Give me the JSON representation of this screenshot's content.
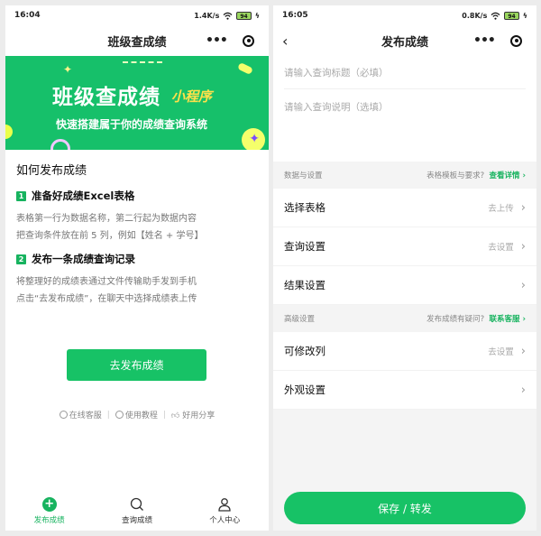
{
  "left": {
    "status": {
      "time": "16:04",
      "speed": "1.4K/s",
      "battery": "94"
    },
    "title": "班级查成绩",
    "banner": {
      "title": "班级查成绩",
      "mini": "小程序",
      "subtitle": "快速搭建属于你的成绩查询系统"
    },
    "howto_title": "如何发布成绩",
    "steps": [
      {
        "num": "1",
        "title": "准备好成绩Excel表格",
        "lines": [
          "表格第一行为数据名称，第二行起为数据内容",
          "把查询条件放在前 5 列，例如【姓名 + 学号】"
        ]
      },
      {
        "num": "2",
        "title": "发布一条成绩查询记录",
        "lines": [
          "将整理好的成绩表通过文件传输助手发到手机",
          "点击“去发布成绩”，在聊天中选择成绩表上传"
        ]
      }
    ],
    "publish_button": "去发布成绩",
    "links": [
      "在线客服",
      "使用教程",
      "好用分享"
    ],
    "tabs": [
      {
        "label": "发布成绩",
        "icon": "plus-circle-icon"
      },
      {
        "label": "查询成绩",
        "icon": "search-icon"
      },
      {
        "label": "个人中心",
        "icon": "user-icon"
      }
    ]
  },
  "right": {
    "status": {
      "time": "16:05",
      "speed": "0.8K/s",
      "battery": "94"
    },
    "title": "发布成绩",
    "title_placeholder": "请输入查询标题（必填）",
    "desc_placeholder": "请输入查询说明（选填）",
    "section1": {
      "label": "数据与设置",
      "hint": "表格模板与要求?",
      "link": "查看详情"
    },
    "rows1": [
      {
        "label": "选择表格",
        "value": "去上传"
      },
      {
        "label": "查询设置",
        "value": "去设置"
      },
      {
        "label": "结果设置",
        "value": ""
      }
    ],
    "section2": {
      "label": "高级设置",
      "hint": "发布成绩有疑问?",
      "link": "联系客服"
    },
    "rows2": [
      {
        "label": "可修改列",
        "value": "去设置"
      },
      {
        "label": "外观设置",
        "value": ""
      }
    ],
    "save_button": "保存 / 转发"
  },
  "colors": {
    "accent": "#17c266",
    "banner": "#16c06a"
  }
}
